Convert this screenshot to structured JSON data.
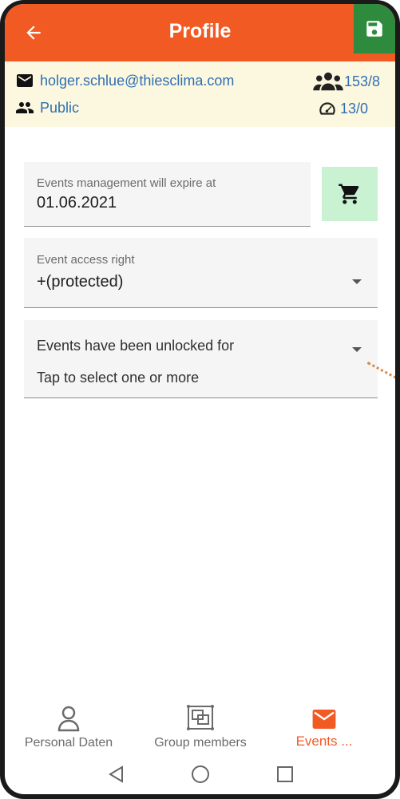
{
  "appbar": {
    "title": "Profile",
    "back_icon": "arrow-back-icon",
    "save_icon": "floppy-disk-icon",
    "color": "#f25a23",
    "save_color": "#2e8b3d"
  },
  "info": {
    "email": "holger.schlue@thiesclima.com",
    "visibility": "Public",
    "members_count": "153/8",
    "speed_count": "13/0",
    "text_color": "#2f6fb3",
    "background": "#fcf8e0"
  },
  "events_management": {
    "label": "Events management will expire at",
    "value": "01.06.2021",
    "cart_icon": "shopping-cart-icon",
    "cart_color": "#c8f2d2"
  },
  "access_right": {
    "label": "Event access right",
    "value": "+(protected)"
  },
  "unlocked": {
    "label": "Events have been unlocked for",
    "hint": "Tap to select one or more"
  },
  "bottom_nav": {
    "items": [
      {
        "label": "Personal Daten",
        "icon": "person-icon",
        "active": false
      },
      {
        "label": "Group members",
        "icon": "group-frame-icon",
        "active": false
      },
      {
        "label": "Events ...",
        "icon": "envelope-icon",
        "active": true
      }
    ]
  },
  "system_nav": {
    "back": "triangle-back-icon",
    "home": "circle-home-icon",
    "recents": "square-recents-icon"
  }
}
